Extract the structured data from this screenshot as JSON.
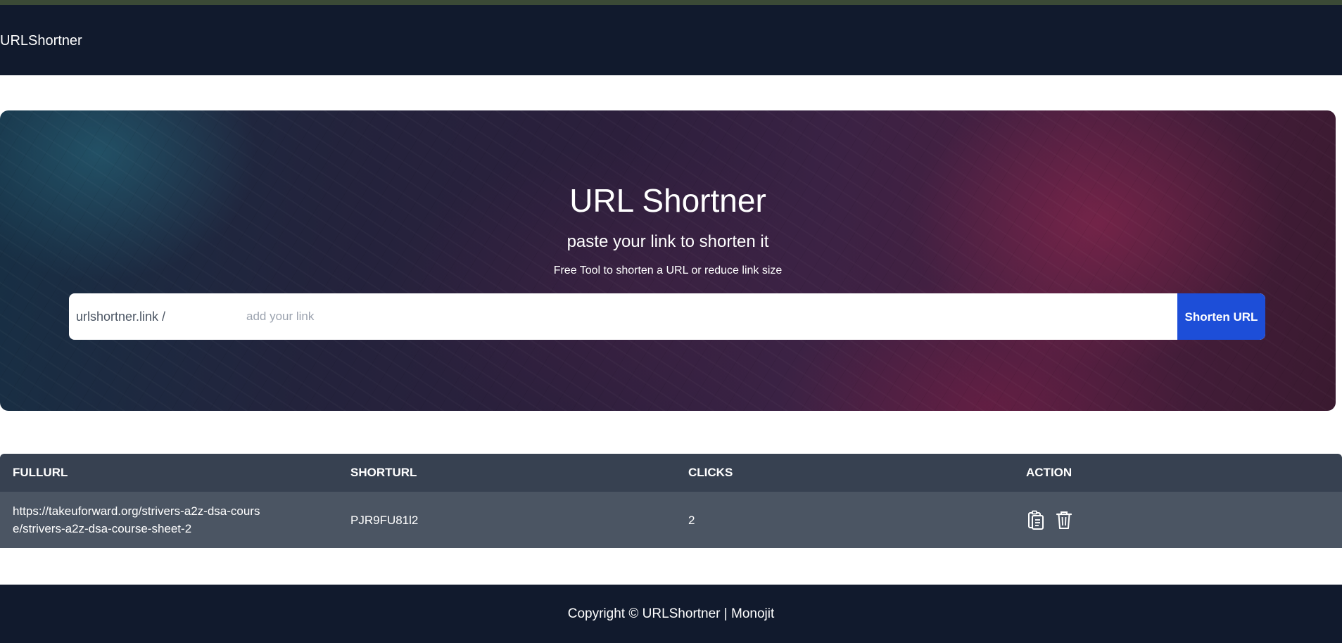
{
  "nav": {
    "brand": "URLShortner"
  },
  "hero": {
    "title": "URL Shortner",
    "subtitle": "paste your link to shorten it",
    "description": "Free Tool to shorten a URL or reduce link size",
    "prefix": "urlshortner.link /",
    "input_placeholder": "add your link",
    "input_value": "",
    "button_label": "Shorten URL"
  },
  "table": {
    "headers": [
      "FULLURL",
      "SHORTURL",
      "CLICKS",
      "ACTION"
    ],
    "rows": [
      {
        "fullurl": "https://takeuforward.org/strivers-a2z-dsa-course/strivers-a2z-dsa-course-sheet-2",
        "shorturl": "PJR9FU81l2",
        "clicks": "2",
        "actions": [
          "clipboard-icon",
          "trash-icon"
        ]
      }
    ]
  },
  "footer": {
    "text": "Copyright © URLShortner | Monojit"
  },
  "colors": {
    "navbar": "#111a2d",
    "accent_button": "#1d4ed8",
    "table_header": "#374151",
    "table_row": "#4b5563"
  }
}
